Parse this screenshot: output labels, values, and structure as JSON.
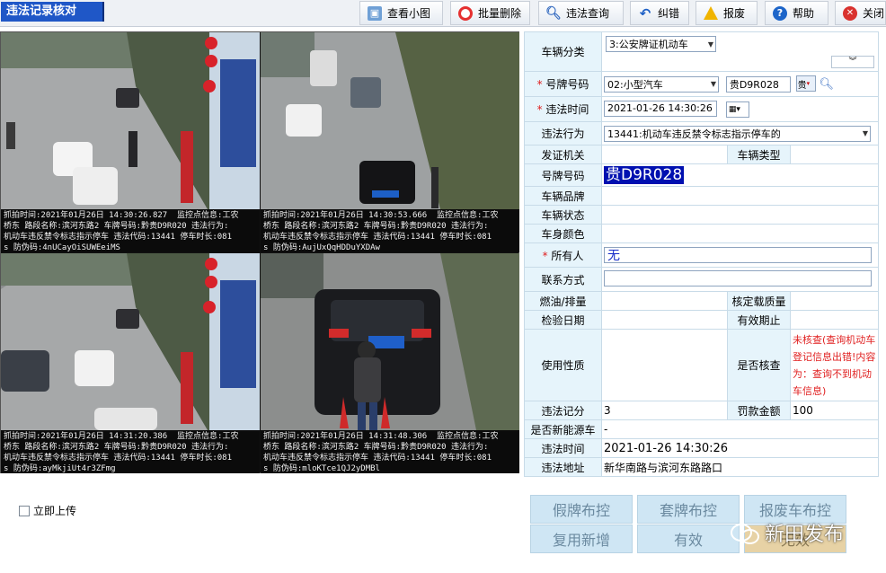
{
  "app_title": "违法记录核对",
  "toolbar": {
    "thumbs": "查看小图",
    "batch_delete": "批量删除",
    "query": "违法查询",
    "correct": "纠错",
    "report": "报废",
    "help": "帮助",
    "close": "关闭"
  },
  "photos": [
    {
      "line1": "抓拍时间:2021年01月26日 14:30:26.827  监控点信息:工农",
      "line2": "桥东 路段名称:滨河东路2 车牌号码:黔贵D9R020 违法行为:",
      "line3": "机动车违反禁令标志指示停车 违法代码:13441 停车时长:081",
      "line4": "s 防伪码:4nUCayOiSUWEeiMS"
    },
    {
      "line1": "抓拍时间:2021年01月26日 14:30:53.666  监控点信息:工农",
      "line2": "桥东 路段名称:滨河东路2 车牌号码:黔贵D9R020 违法行为:",
      "line3": "机动车违反禁令标志指示停车 违法代码:13441 停车时长:081",
      "line4": "s 防伪码:AujUxQqHDDuYXDAw"
    },
    {
      "line1": "抓拍时间:2021年01月26日 14:31:20.386  监控点信息:工农",
      "line2": "桥东 路段名称:滨河东路2 车牌号码:黔贵D9R020 违法行为:",
      "line3": "机动车违反禁令标志指示停车 违法代码:13441 停车时长:081",
      "line4": "s 防伪码:ayMkjiUt4r3ZFmg"
    },
    {
      "line1": "抓拍时间:2021年01月26日 14:31:48.306  监控点信息:工农",
      "line2": "桥东 路段名称:滨河东路2 车牌号码:黔贵D9R020 违法行为:",
      "line3": "机动车违反禁令标志指示停车 违法代码:13441 停车时长:081",
      "line4": "s 防伪码:mloKTce1QJ2yDMBl"
    }
  ],
  "form": {
    "vehicle_category_label": "车辆分类",
    "vehicle_category_value": "3:公安牌证机动车",
    "plate_label": "号牌号码",
    "plate_type_value": "02:小型汽车",
    "plate_number_value": "贵D9R028",
    "plate_prefix_btn": "贵",
    "time_label": "违法时间",
    "time_value": "2021-01-26 14:30:26",
    "behavior_label": "违法行为",
    "behavior_value": "13441:机动车违反禁令标志指示停车的",
    "issuer_label": "发证机关",
    "vehicle_type_label": "车辆类型",
    "plate_display_label": "号牌号码",
    "plate_display_value": "贵D9R028",
    "brand_label": "车辆品牌",
    "status_label": "车辆状态",
    "color_label": "车身颜色",
    "owner_label": "所有人",
    "owner_value": "无",
    "contact_label": "联系方式",
    "fuel_label": "燃油/排量",
    "load_label": "核定载质量",
    "inspect_label": "检验日期",
    "valid_label": "有效期止",
    "usage_label": "使用性质",
    "verified_label": "是否核查",
    "verified_value": "未核查(查询机动车登记信息出错!内容为：查询不到机动车信息)",
    "points_label": "违法记分",
    "points_value": "3",
    "fine_label": "罚款金额",
    "fine_value": "100",
    "new_energy_label": "是否新能源车",
    "new_energy_value": "-",
    "time2_label": "违法时间",
    "time2_value": "2021-01-26 14:30:26",
    "address_label": "违法地址",
    "address_value": "新华南路与滨河东路路口"
  },
  "upload_label": "立即上传",
  "actions": {
    "fake_plate": "假牌布控",
    "cloned_plate": "套牌布控",
    "scrapped": "报废车布控",
    "reuse": "复用新增",
    "valid": "有效",
    "invalid": "无效"
  },
  "watermark": "新田发布",
  "colors": {
    "title_bg": "#1f57c7",
    "label_bg": "#e6f4fb",
    "plate_bg": "#0010b0",
    "action_bg": "#cfe6f4",
    "alert": "#e02020"
  }
}
